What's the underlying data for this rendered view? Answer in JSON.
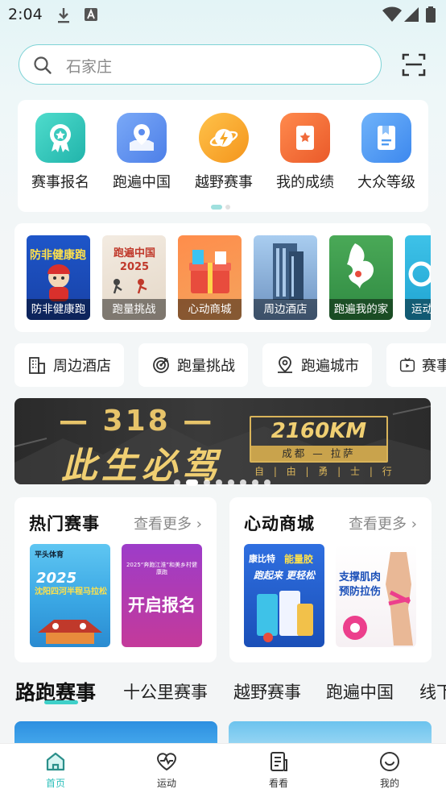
{
  "status_bar": {
    "time": "2:04"
  },
  "search": {
    "placeholder": "石家庄"
  },
  "quick_access": {
    "items": [
      {
        "label": "赛事报名",
        "icon": "award-badge-icon",
        "color": "#33c9bd"
      },
      {
        "label": "跑遍中国",
        "icon": "location-pin-icon",
        "color": "#5e8ff0"
      },
      {
        "label": "越野赛事",
        "icon": "lightning-globe-icon",
        "color": "#f5a623"
      },
      {
        "label": "我的成绩",
        "icon": "star-certificate-icon",
        "color": "#f06a3a"
      },
      {
        "label": "大众等级",
        "icon": "bookmark-book-icon",
        "color": "#4f9bf2"
      }
    ]
  },
  "features": {
    "items": [
      {
        "label": "防非健康跑",
        "overlay": "防非健康跑"
      },
      {
        "label": "跑量挑战",
        "overlay": "跑遍中国 2025"
      },
      {
        "label": "心动商城"
      },
      {
        "label": "周边酒店"
      },
      {
        "label": "跑遍我的家"
      },
      {
        "label": "运动"
      }
    ]
  },
  "shortcuts": [
    {
      "label": "周边酒店",
      "icon": "building-icon"
    },
    {
      "label": "跑量挑战",
      "icon": "target-icon"
    },
    {
      "label": "跑遍城市",
      "icon": "map-pin-icon"
    },
    {
      "label": "赛事",
      "icon": "video-play-icon"
    }
  ],
  "banner": {
    "line1": "— 318 —",
    "line2": "此生必驾",
    "distance": "2160KM",
    "route": "成都 — 拉萨",
    "slogan": "自 | 由 | 勇 | 士 | 行",
    "dot_count": 8,
    "active_dot": 1
  },
  "hot_events": {
    "title": "热门赛事",
    "more": "查看更多",
    "items": [
      {
        "brand": "平头体育",
        "year": "2025",
        "title": "沈阳四河半程马拉松"
      },
      {
        "header": "2025“奔跑江淮”和美乡村健康跑",
        "title": "开启报名"
      }
    ]
  },
  "mall": {
    "title": "心动商城",
    "more": "查看更多",
    "items": [
      {
        "brand": "康比特",
        "headline": "能量胶",
        "slogan": "跑起来 更轻松"
      },
      {
        "line1": "支撑肌肉",
        "line2": "预防拉伤"
      }
    ]
  },
  "category_tabs": [
    "路跑赛事",
    "十公里赛事",
    "越野赛事",
    "跑遍中国",
    "线下"
  ],
  "bottom_nav": [
    {
      "label": "首页",
      "icon": "home-icon",
      "active": true
    },
    {
      "label": "运动",
      "icon": "heartbeat-icon",
      "active": false
    },
    {
      "label": "看看",
      "icon": "article-icon",
      "active": false
    },
    {
      "label": "我的",
      "icon": "smile-face-icon",
      "active": false
    }
  ],
  "colors": {
    "accent": "#2bbfba",
    "search_border": "#7ed3d6"
  }
}
